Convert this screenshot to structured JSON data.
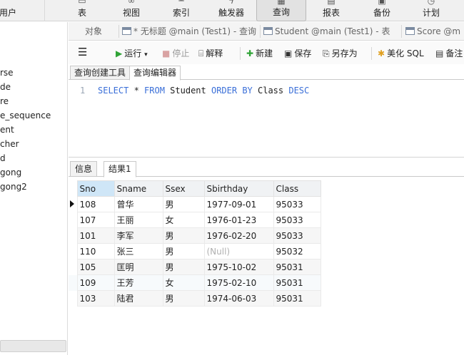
{
  "ribbon": {
    "items": [
      {
        "label": "用户",
        "icon": "user-icon"
      },
      {
        "label": "表",
        "icon": "table-icon"
      },
      {
        "label": "视图",
        "icon": "view-icon"
      },
      {
        "label": "索引",
        "icon": "index-icon"
      },
      {
        "label": "触发器",
        "icon": "trigger-icon"
      },
      {
        "label": "查询",
        "icon": "query-icon"
      },
      {
        "label": "报表",
        "icon": "report-icon"
      },
      {
        "label": "备份",
        "icon": "backup-icon"
      },
      {
        "label": "计划",
        "icon": "schedule-icon"
      }
    ]
  },
  "nav": {
    "items": [
      "rse",
      "de",
      "re",
      "e_sequence",
      "ent",
      "cher",
      "d",
      "gong",
      "gong2"
    ]
  },
  "tabs": [
    {
      "label": "对象"
    },
    {
      "label": "* 无标题 @main (Test1) - 查询"
    },
    {
      "label": "Student @main (Test1) - 表"
    },
    {
      "label": "Score @m"
    }
  ],
  "toolbar": {
    "run": "运行",
    "stop": "停止",
    "explain": "解释",
    "new": "新建",
    "save": "保存",
    "save_as": "另存为",
    "beautify": "美化 SQL",
    "note": "备注"
  },
  "subtabs": {
    "builder": "查询创建工具",
    "editor": "查询编辑器"
  },
  "editor": {
    "line_number": "1",
    "kw_select": "SELECT",
    "star": " * ",
    "kw_from": "FROM",
    "table": " Student ",
    "kw_order": "ORDER BY",
    "column": " Class ",
    "kw_desc": "DESC"
  },
  "result_tabs": {
    "info": "信息",
    "result": "结果1"
  },
  "grid": {
    "columns": [
      "Sno",
      "Sname",
      "Ssex",
      "Sbirthday",
      "Class"
    ],
    "rows": [
      [
        "108",
        "曾华",
        "男",
        "1977-09-01",
        "95033"
      ],
      [
        "107",
        "王丽",
        "女",
        "1976-01-23",
        "95033"
      ],
      [
        "101",
        "李军",
        "男",
        "1976-02-20",
        "95033"
      ],
      [
        "110",
        "张三",
        "男",
        "(Null)",
        "95032"
      ],
      [
        "105",
        "匡明",
        "男",
        "1975-10-02",
        "95031"
      ],
      [
        "109",
        "王芳",
        "女",
        "1975-02-10",
        "95031"
      ],
      [
        "103",
        "陆君",
        "男",
        "1974-06-03",
        "95031"
      ]
    ]
  }
}
